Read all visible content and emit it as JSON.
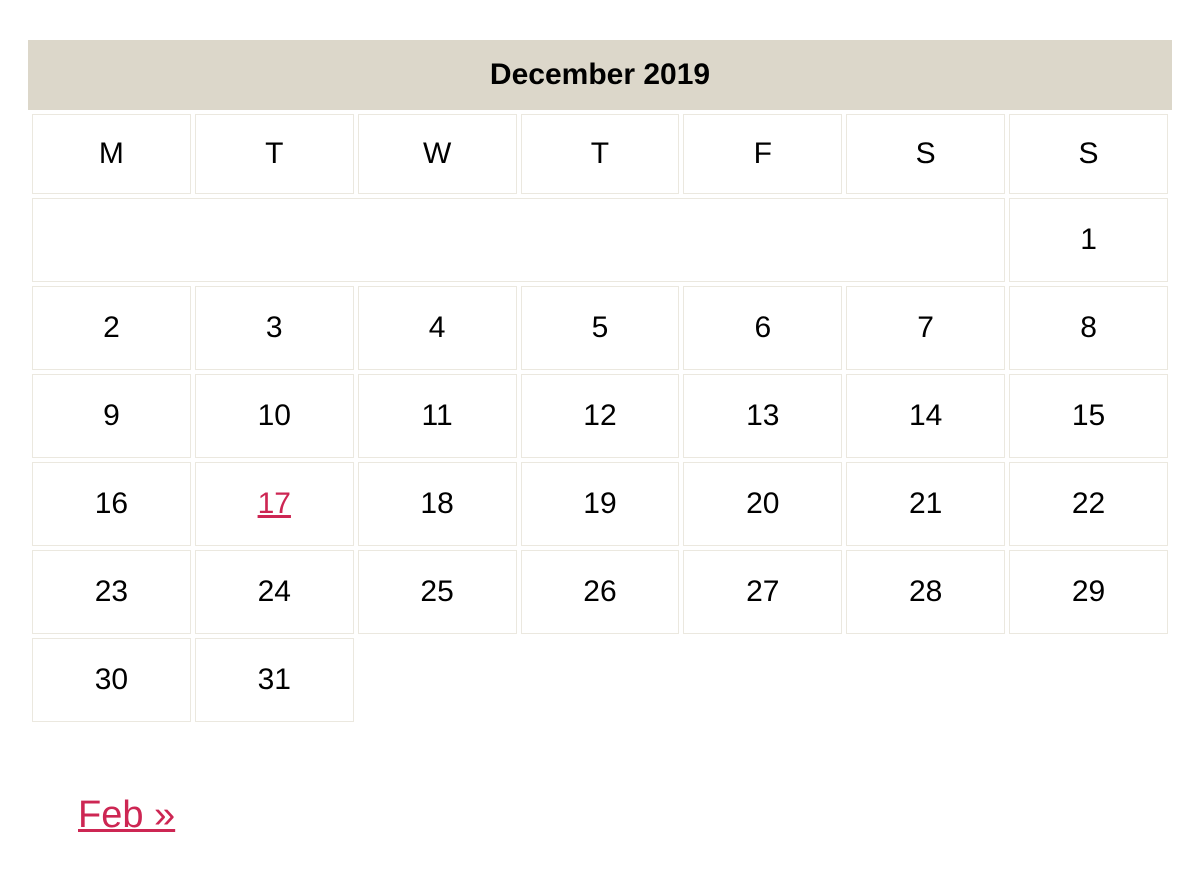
{
  "caption": "December 2019",
  "headers": [
    "M",
    "T",
    "W",
    "T",
    "F",
    "S",
    "S"
  ],
  "rows": [
    [
      {
        "type": "pad",
        "colspan": 6
      },
      {
        "type": "day",
        "text": "1"
      }
    ],
    [
      {
        "type": "day",
        "text": "2"
      },
      {
        "type": "day",
        "text": "3"
      },
      {
        "type": "day",
        "text": "4"
      },
      {
        "type": "day",
        "text": "5"
      },
      {
        "type": "day",
        "text": "6"
      },
      {
        "type": "day",
        "text": "7"
      },
      {
        "type": "day",
        "text": "8"
      }
    ],
    [
      {
        "type": "day",
        "text": "9"
      },
      {
        "type": "day",
        "text": "10"
      },
      {
        "type": "day",
        "text": "11"
      },
      {
        "type": "day",
        "text": "12"
      },
      {
        "type": "day",
        "text": "13"
      },
      {
        "type": "day",
        "text": "14"
      },
      {
        "type": "day",
        "text": "15"
      }
    ],
    [
      {
        "type": "day",
        "text": "16"
      },
      {
        "type": "link",
        "text": "17"
      },
      {
        "type": "day",
        "text": "18"
      },
      {
        "type": "day",
        "text": "19"
      },
      {
        "type": "day",
        "text": "20"
      },
      {
        "type": "day",
        "text": "21"
      },
      {
        "type": "day",
        "text": "22"
      }
    ],
    [
      {
        "type": "day",
        "text": "23"
      },
      {
        "type": "day",
        "text": "24"
      },
      {
        "type": "day",
        "text": "25"
      },
      {
        "type": "day",
        "text": "26"
      },
      {
        "type": "day",
        "text": "27"
      },
      {
        "type": "day",
        "text": "28"
      },
      {
        "type": "day",
        "text": "29"
      }
    ],
    [
      {
        "type": "day",
        "text": "30"
      },
      {
        "type": "day",
        "text": "31"
      },
      {
        "type": "empty-tail",
        "colspan": 5
      }
    ]
  ],
  "nav": {
    "next_label": "Feb »"
  }
}
